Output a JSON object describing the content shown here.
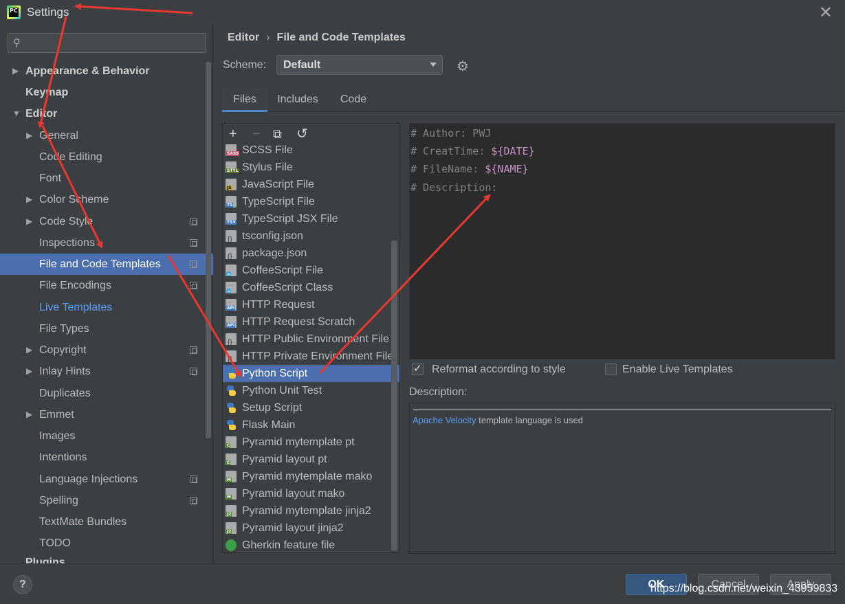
{
  "window": {
    "title": "Settings",
    "app_icon_text": "PC"
  },
  "search": {
    "placeholder": ""
  },
  "sidebar": {
    "items": [
      {
        "label": "Appearance & Behavior",
        "arrow": "▶"
      },
      {
        "label": "Keymap"
      },
      {
        "label": "Editor",
        "arrow": "▼"
      },
      {
        "label": "General",
        "arrow": "▶"
      },
      {
        "label": "Code Editing"
      },
      {
        "label": "Font"
      },
      {
        "label": "Color Scheme",
        "arrow": "▶"
      },
      {
        "label": "Code Style",
        "arrow": "▶"
      },
      {
        "label": "Inspections"
      },
      {
        "label": "File and Code Templates"
      },
      {
        "label": "File Encodings"
      },
      {
        "label": "Live Templates"
      },
      {
        "label": "File Types"
      },
      {
        "label": "Copyright",
        "arrow": "▶"
      },
      {
        "label": "Inlay Hints",
        "arrow": "▶"
      },
      {
        "label": "Duplicates"
      },
      {
        "label": "Emmet",
        "arrow": "▶"
      },
      {
        "label": "Images"
      },
      {
        "label": "Intentions"
      },
      {
        "label": "Language Injections"
      },
      {
        "label": "Spelling"
      },
      {
        "label": "TextMate Bundles"
      },
      {
        "label": "TODO"
      },
      {
        "label": "Plugins"
      }
    ]
  },
  "breadcrumb": {
    "part1": "Editor",
    "separator": "›",
    "part2": "File and Code Templates"
  },
  "scheme": {
    "label": "Scheme:",
    "value": "Default"
  },
  "tabs": [
    {
      "label": "Files"
    },
    {
      "label": "Includes"
    },
    {
      "label": "Code"
    }
  ],
  "toolbar": {
    "add": "+",
    "remove": "−",
    "copy": "⧉",
    "reset": "↺"
  },
  "templates": [
    {
      "label": "SCSS File",
      "badge": "SASS"
    },
    {
      "label": "Stylus File",
      "badge": "STYL"
    },
    {
      "label": "JavaScript File",
      "badge": "JS"
    },
    {
      "label": "TypeScript File",
      "badge": "TS"
    },
    {
      "label": "TypeScript JSX File",
      "badge": "TSX"
    },
    {
      "label": "tsconfig.json"
    },
    {
      "label": "package.json"
    },
    {
      "label": "CoffeeScript File"
    },
    {
      "label": "CoffeeScript Class"
    },
    {
      "label": "HTTP Request",
      "badge": "API"
    },
    {
      "label": "HTTP Request Scratch",
      "badge": "API"
    },
    {
      "label": "HTTP Public Environment File"
    },
    {
      "label": "HTTP Private Environment File"
    },
    {
      "label": "Python Script"
    },
    {
      "label": "Python Unit Test"
    },
    {
      "label": "Setup Script"
    },
    {
      "label": "Flask Main"
    },
    {
      "label": "Pyramid mytemplate pt",
      "badge": "C"
    },
    {
      "label": "Pyramid layout pt",
      "badge": "C"
    },
    {
      "label": "Pyramid mytemplate mako",
      "badge": "M"
    },
    {
      "label": "Pyramid layout mako",
      "badge": "M"
    },
    {
      "label": "Pyramid mytemplate jinja2",
      "badge": "J2"
    },
    {
      "label": "Pyramid layout jinja2",
      "badge": "J2"
    },
    {
      "label": "Gherkin feature file"
    }
  ],
  "editor": {
    "lines": [
      {
        "text": "# Author: PWJ",
        "var": ""
      },
      {
        "text": "# CreatTime: ",
        "var": "${DATE}"
      },
      {
        "text": "# FileName: ",
        "var": "${NAME}"
      },
      {
        "text": "# Description:",
        "var": ""
      }
    ]
  },
  "options": {
    "reformat": {
      "label": "Reformat according to style",
      "checked": true
    },
    "live_templates": {
      "label": "Enable Live Templates",
      "checked": false
    }
  },
  "description": {
    "label": "Description:",
    "link": "Apache Velocity",
    "text": " template language is used"
  },
  "buttons": {
    "help": "?",
    "ok": "OK",
    "cancel": "Cancel",
    "apply": "Apply"
  },
  "watermark": "https://blog.csdn.net/weixin_43959833",
  "colors": {
    "accent": "#4b6eaf",
    "annotation": "#e8382f",
    "link": "#589df6",
    "template_var": "#c993ca"
  }
}
